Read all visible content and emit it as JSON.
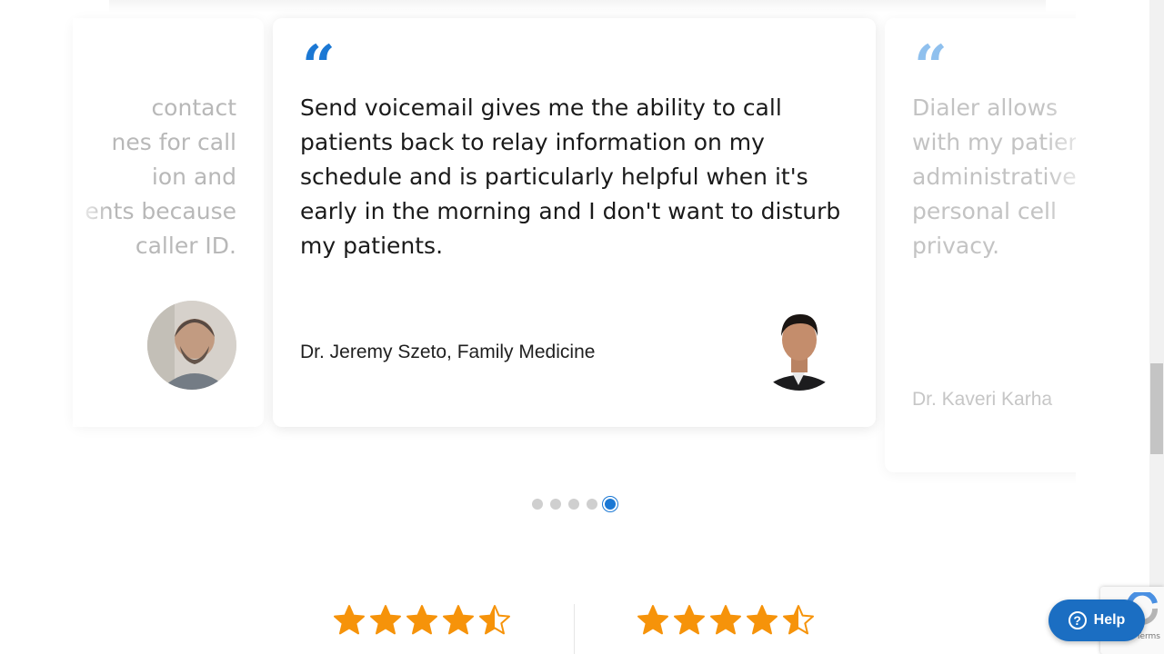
{
  "carousel": {
    "prev": {
      "text": "contact\nnes for call\nion and\nents because\ncaller ID."
    },
    "current": {
      "quote_mark": "“",
      "text": "Send voicemail gives me the ability to call patients back to relay information on my schedule and is particularly helpful when it's early in the morning and I don't want to disturb my patients.",
      "author": "Dr. Jeremy Szeto, Family Medicine"
    },
    "next": {
      "quote_mark": "“",
      "text": "Dialer allows\nwith my patien\nadministrative\npersonal cell\nprivacy.",
      "author": "Dr. Kaveri Karha"
    },
    "dots_total": 5,
    "active_dot": 5
  },
  "ratings": [
    {
      "stars": 4.5,
      "color": "#f6930a"
    },
    {
      "stars": 4.5,
      "color": "#f6930a"
    }
  ],
  "recaptcha": {
    "text": "Terms"
  },
  "help": {
    "label": "Help",
    "icon": "question-icon"
  },
  "colors": {
    "accent": "#1b78d4",
    "star": "#f6930a"
  }
}
